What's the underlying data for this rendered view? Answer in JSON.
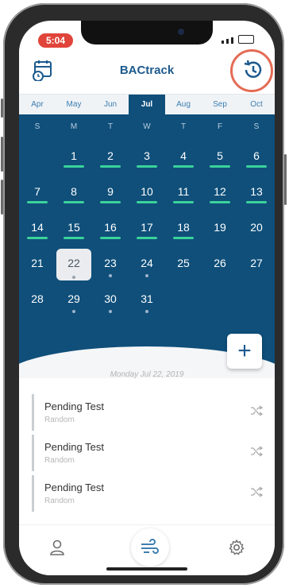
{
  "status": {
    "time": "5:04"
  },
  "header": {
    "title": "BACtrack",
    "calendar_icon": "calendar-clock-icon",
    "history_icon": "history-icon",
    "highlight_color": "#e56b55"
  },
  "months": [
    {
      "label": "Apr",
      "active": false
    },
    {
      "label": "May",
      "active": false
    },
    {
      "label": "Jun",
      "active": false
    },
    {
      "label": "Jul",
      "active": true
    },
    {
      "label": "Aug",
      "active": false
    },
    {
      "label": "Sep",
      "active": false
    },
    {
      "label": "Oct",
      "active": false
    }
  ],
  "calendar": {
    "background": "#0f4f7a",
    "marker_color": "#3bd39a",
    "weekdays": [
      "S",
      "M",
      "T",
      "W",
      "T",
      "F",
      "S"
    ],
    "weeks": [
      [
        {
          "d": ""
        },
        {
          "d": "1",
          "bar": true
        },
        {
          "d": "2",
          "bar": true
        },
        {
          "d": "3",
          "bar": true
        },
        {
          "d": "4",
          "bar": true
        },
        {
          "d": "5",
          "bar": true
        },
        {
          "d": "6",
          "bar": true
        }
      ],
      [
        {
          "d": "7",
          "bar": true
        },
        {
          "d": "8",
          "bar": true
        },
        {
          "d": "9",
          "bar": true
        },
        {
          "d": "10",
          "bar": true
        },
        {
          "d": "11",
          "bar": true
        },
        {
          "d": "12",
          "bar": true
        },
        {
          "d": "13",
          "bar": true
        }
      ],
      [
        {
          "d": "14",
          "bar": true
        },
        {
          "d": "15",
          "bar": true
        },
        {
          "d": "16",
          "bar": true
        },
        {
          "d": "17",
          "bar": true
        },
        {
          "d": "18",
          "bar": true
        },
        {
          "d": "19"
        },
        {
          "d": "20"
        }
      ],
      [
        {
          "d": "21"
        },
        {
          "d": "22",
          "dot": true,
          "selected": true
        },
        {
          "d": "23",
          "dot": true
        },
        {
          "d": "24",
          "dot": true
        },
        {
          "d": "25"
        },
        {
          "d": "26"
        },
        {
          "d": "27"
        }
      ],
      [
        {
          "d": "28"
        },
        {
          "d": "29",
          "dot": true
        },
        {
          "d": "30",
          "dot": true
        },
        {
          "d": "31",
          "dot": true
        },
        {
          "d": ""
        },
        {
          "d": ""
        },
        {
          "d": ""
        }
      ]
    ]
  },
  "add_button": {
    "label": "+"
  },
  "selected_date": "Monday Jul 22, 2019",
  "tests": [
    {
      "title": "Pending Test",
      "subtitle": "Random"
    },
    {
      "title": "Pending Test",
      "subtitle": "Random"
    },
    {
      "title": "Pending Test",
      "subtitle": "Random"
    }
  ],
  "tabs": [
    {
      "name": "profile-tab",
      "icon": "person-icon"
    },
    {
      "name": "blow-tab",
      "icon": "wind-icon"
    },
    {
      "name": "settings-tab",
      "icon": "gear-icon"
    }
  ]
}
